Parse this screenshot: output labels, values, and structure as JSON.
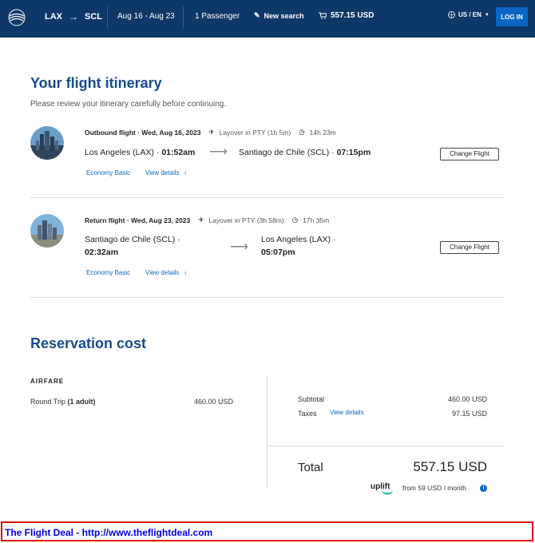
{
  "header": {
    "origin": "LAX",
    "destination": "SCL",
    "dates": "Aug 16 - Aug 23",
    "passengers": "1 Passenger",
    "new_search": "New search",
    "cart_total": "557.15 USD",
    "locale": "US / EN",
    "login": "LOG IN"
  },
  "itinerary": {
    "title": "Your flight itinerary",
    "subtitle": "Please review your itinerary carefully before continuing.",
    "flights": [
      {
        "type": "Outbound flight",
        "date": "Wed, Aug 16, 2023",
        "layover": "Layover in PTY (1h 5m)",
        "duration": "14h 23m",
        "from_city": "Los Angeles (LAX) ·",
        "from_time": "01:52am",
        "to_city": "Santiago de Chile (SCL) ·",
        "to_time": "07:15pm",
        "fare": "Economy Basic",
        "details": "View details",
        "change": "Change Flight"
      },
      {
        "type": "Return flight",
        "date": "Wed, Aug 23, 2023",
        "layover": "Layover in PTY (3h 58m)",
        "duration": "17h 35m",
        "from_city": "Santiago de Chile (SCL) ·",
        "from_time": "02:32am",
        "to_city": "Los Angeles (LAX) ·",
        "to_time": "05:07pm",
        "fare": "Economy Basic",
        "details": "View details",
        "change": "Change Flight"
      }
    ]
  },
  "cost": {
    "title": "Reservation cost",
    "airfare_heading": "AIRFARE",
    "trip_label_pre": "Round Trip ",
    "trip_label_bold": "(1 adult)",
    "trip_amount": "460.00 USD",
    "subtotal_label": "Subtotal",
    "subtotal_amount": "460.00 USD",
    "taxes_label": "Taxes",
    "taxes_link": "View details",
    "taxes_amount": "97.15 USD",
    "total_label": "Total",
    "total_amount": "557.15 USD",
    "uplift_brand": "uplift",
    "uplift_text": "from 59 USD  / month"
  },
  "banner": {
    "text": "The Flight Deal - http://www.theflightdeal.com"
  },
  "colors": {
    "header_bg": "#0e3867",
    "heading_blue": "#1a4b8c",
    "link_blue": "#0a66c2",
    "banner_border": "#e00000"
  }
}
